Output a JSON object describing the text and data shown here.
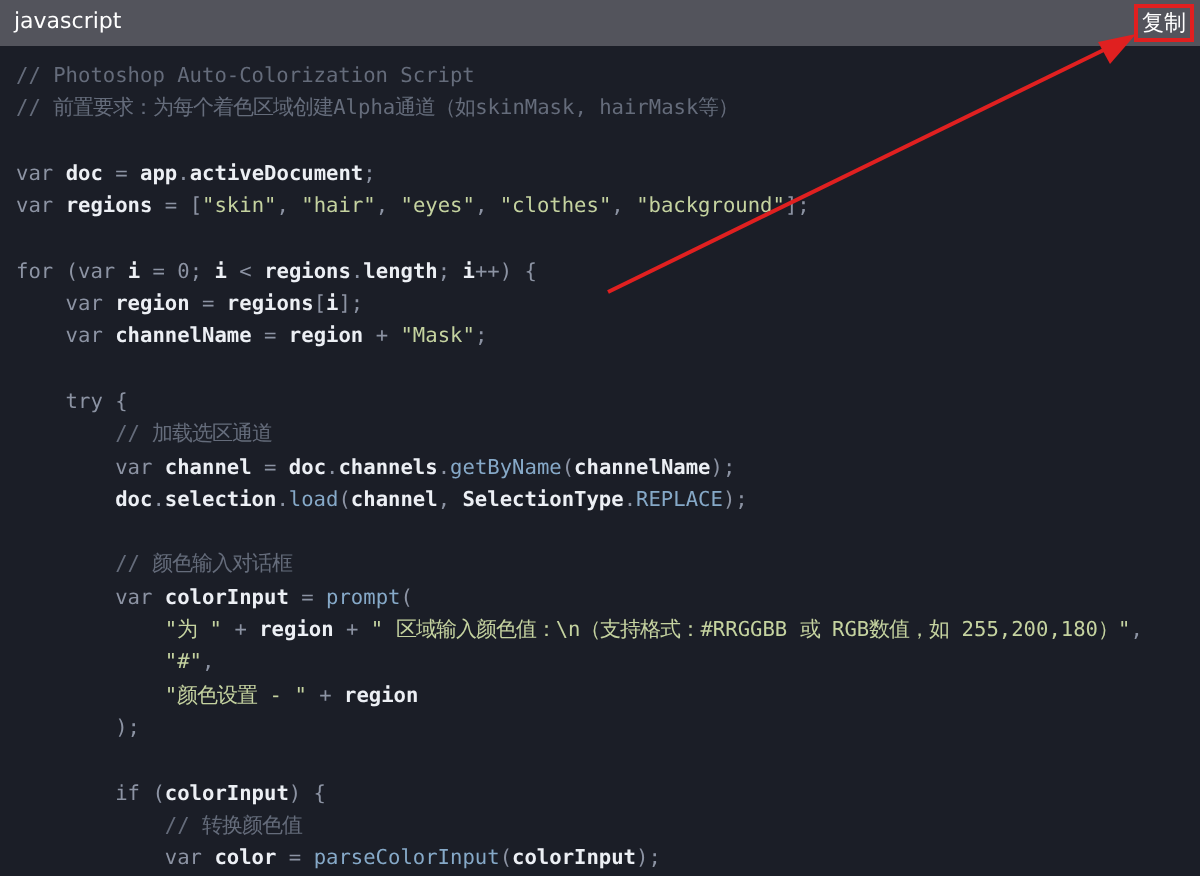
{
  "header": {
    "language": "javascript",
    "copy_button": {
      "label": "复制",
      "highlighted": true
    }
  },
  "code": [
    {
      "kind": "code",
      "tokens": [
        {
          "kind": "comment",
          "text": "// Photoshop Auto-Colorization Script"
        }
      ]
    },
    {
      "kind": "code",
      "tokens": [
        {
          "kind": "comment",
          "text": "// 前置要求：为每个着色区域创建Alpha通道（如skinMask, hairMask等）"
        }
      ]
    },
    {
      "kind": "blank"
    },
    {
      "kind": "code",
      "tokens": [
        {
          "kind": "keyword",
          "text": "var "
        },
        {
          "kind": "ident",
          "text": "doc"
        },
        {
          "kind": "punct",
          "text": " = "
        },
        {
          "kind": "ident",
          "text": "app"
        },
        {
          "kind": "punct",
          "text": "."
        },
        {
          "kind": "ident",
          "text": "activeDocument"
        },
        {
          "kind": "punct",
          "text": ";"
        }
      ]
    },
    {
      "kind": "code",
      "tokens": [
        {
          "kind": "keyword",
          "text": "var "
        },
        {
          "kind": "ident",
          "text": "regions"
        },
        {
          "kind": "punct",
          "text": " = ["
        },
        {
          "kind": "string",
          "text": "\"skin\""
        },
        {
          "kind": "punct",
          "text": ", "
        },
        {
          "kind": "string",
          "text": "\"hair\""
        },
        {
          "kind": "punct",
          "text": ", "
        },
        {
          "kind": "string",
          "text": "\"eyes\""
        },
        {
          "kind": "punct",
          "text": ", "
        },
        {
          "kind": "string",
          "text": "\"clothes\""
        },
        {
          "kind": "punct",
          "text": ", "
        },
        {
          "kind": "string",
          "text": "\"background\""
        },
        {
          "kind": "punct",
          "text": "];"
        }
      ]
    },
    {
      "kind": "blank"
    },
    {
      "kind": "code",
      "tokens": [
        {
          "kind": "keyword",
          "text": "for "
        },
        {
          "kind": "punct",
          "text": "("
        },
        {
          "kind": "keyword",
          "text": "var "
        },
        {
          "kind": "ident",
          "text": "i"
        },
        {
          "kind": "punct",
          "text": " = "
        },
        {
          "kind": "number",
          "text": "0"
        },
        {
          "kind": "punct",
          "text": "; "
        },
        {
          "kind": "ident",
          "text": "i"
        },
        {
          "kind": "punct",
          "text": " < "
        },
        {
          "kind": "ident",
          "text": "regions"
        },
        {
          "kind": "punct",
          "text": "."
        },
        {
          "kind": "ident",
          "text": "length"
        },
        {
          "kind": "punct",
          "text": "; "
        },
        {
          "kind": "ident",
          "text": "i"
        },
        {
          "kind": "punct",
          "text": "++) {"
        }
      ],
      "children": [
        {
          "kind": "code",
          "tokens": [
            {
              "kind": "keyword",
              "text": "var "
            },
            {
              "kind": "ident",
              "text": "region"
            },
            {
              "kind": "punct",
              "text": " = "
            },
            {
              "kind": "ident",
              "text": "regions"
            },
            {
              "kind": "punct",
              "text": "["
            },
            {
              "kind": "ident",
              "text": "i"
            },
            {
              "kind": "punct",
              "text": "];"
            }
          ]
        },
        {
          "kind": "code",
          "tokens": [
            {
              "kind": "keyword",
              "text": "var "
            },
            {
              "kind": "ident",
              "text": "channelName"
            },
            {
              "kind": "punct",
              "text": " = "
            },
            {
              "kind": "ident",
              "text": "region"
            },
            {
              "kind": "punct",
              "text": " + "
            },
            {
              "kind": "string",
              "text": "\"Mask\""
            },
            {
              "kind": "punct",
              "text": ";"
            }
          ]
        },
        {
          "kind": "blank"
        },
        {
          "kind": "code",
          "tokens": [
            {
              "kind": "keyword",
              "text": "try "
            },
            {
              "kind": "punct",
              "text": "{"
            }
          ],
          "children": [
            {
              "kind": "code",
              "tokens": [
                {
                  "kind": "comment",
                  "text": "// 加载选区通道"
                }
              ]
            },
            {
              "kind": "code",
              "tokens": [
                {
                  "kind": "keyword",
                  "text": "var "
                },
                {
                  "kind": "ident",
                  "text": "channel"
                },
                {
                  "kind": "punct",
                  "text": " = "
                },
                {
                  "kind": "ident",
                  "text": "doc"
                },
                {
                  "kind": "punct",
                  "text": "."
                },
                {
                  "kind": "ident",
                  "text": "channels"
                },
                {
                  "kind": "punct",
                  "text": "."
                },
                {
                  "kind": "func",
                  "text": "getByName"
                },
                {
                  "kind": "punct",
                  "text": "("
                },
                {
                  "kind": "ident",
                  "text": "channelName"
                },
                {
                  "kind": "punct",
                  "text": ");"
                }
              ]
            },
            {
              "kind": "code",
              "tokens": [
                {
                  "kind": "ident",
                  "text": "doc"
                },
                {
                  "kind": "punct",
                  "text": "."
                },
                {
                  "kind": "ident",
                  "text": "selection"
                },
                {
                  "kind": "punct",
                  "text": "."
                },
                {
                  "kind": "func",
                  "text": "load"
                },
                {
                  "kind": "punct",
                  "text": "("
                },
                {
                  "kind": "ident",
                  "text": "channel"
                },
                {
                  "kind": "punct",
                  "text": ", "
                },
                {
                  "kind": "ident",
                  "text": "SelectionType"
                },
                {
                  "kind": "punct",
                  "text": "."
                },
                {
                  "kind": "func",
                  "text": "REPLACE"
                },
                {
                  "kind": "punct",
                  "text": ");"
                }
              ]
            },
            {
              "kind": "blank"
            },
            {
              "kind": "code",
              "tokens": [
                {
                  "kind": "comment",
                  "text": "// 颜色输入对话框"
                }
              ]
            },
            {
              "kind": "code",
              "tokens": [
                {
                  "kind": "keyword",
                  "text": "var "
                },
                {
                  "kind": "ident",
                  "text": "colorInput"
                },
                {
                  "kind": "punct",
                  "text": " = "
                },
                {
                  "kind": "func",
                  "text": "prompt"
                },
                {
                  "kind": "punct",
                  "text": "("
                }
              ],
              "children": [
                {
                  "kind": "code",
                  "tokens": [
                    {
                      "kind": "string",
                      "text": "\"为 \""
                    },
                    {
                      "kind": "punct",
                      "text": " + "
                    },
                    {
                      "kind": "ident",
                      "text": "region"
                    },
                    {
                      "kind": "punct",
                      "text": " + "
                    },
                    {
                      "kind": "string",
                      "text": "\" 区域输入颜色值：\\n（支持格式：#RRGGBB 或 RGB数值，如 255,200,180）\""
                    },
                    {
                      "kind": "punct",
                      "text": ","
                    }
                  ]
                },
                {
                  "kind": "code",
                  "tokens": [
                    {
                      "kind": "string",
                      "text": "\"#\""
                    },
                    {
                      "kind": "punct",
                      "text": ","
                    }
                  ]
                },
                {
                  "kind": "code",
                  "tokens": [
                    {
                      "kind": "string",
                      "text": "\"颜色设置 - \""
                    },
                    {
                      "kind": "punct",
                      "text": " + "
                    },
                    {
                      "kind": "ident",
                      "text": "region"
                    }
                  ]
                }
              ]
            },
            {
              "kind": "code",
              "tokens": [
                {
                  "kind": "punct",
                  "text": ");"
                }
              ]
            },
            {
              "kind": "blank"
            },
            {
              "kind": "code",
              "tokens": [
                {
                  "kind": "keyword",
                  "text": "if "
                },
                {
                  "kind": "punct",
                  "text": "("
                },
                {
                  "kind": "ident",
                  "text": "colorInput"
                },
                {
                  "kind": "punct",
                  "text": ") {"
                }
              ],
              "children": [
                {
                  "kind": "code",
                  "tokens": [
                    {
                      "kind": "comment",
                      "text": "// 转换颜色值"
                    }
                  ]
                },
                {
                  "kind": "code",
                  "tokens": [
                    {
                      "kind": "keyword",
                      "text": "var "
                    },
                    {
                      "kind": "ident",
                      "text": "color"
                    },
                    {
                      "kind": "punct",
                      "text": " = "
                    },
                    {
                      "kind": "func",
                      "text": "parseColorInput"
                    },
                    {
                      "kind": "punct",
                      "text": "("
                    },
                    {
                      "kind": "ident",
                      "text": "colorInput"
                    },
                    {
                      "kind": "punct",
                      "text": ");"
                    }
                  ]
                }
              ]
            }
          ]
        }
      ]
    }
  ]
}
